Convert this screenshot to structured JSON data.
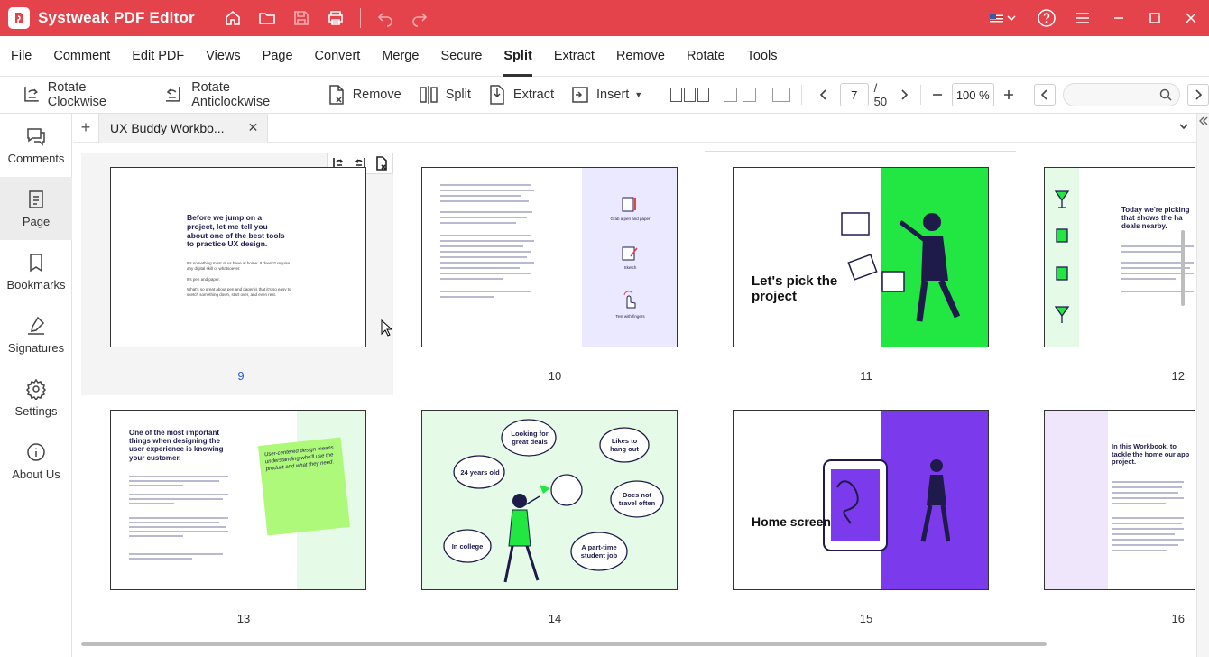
{
  "app": {
    "title": "Systweak PDF Editor"
  },
  "menu": {
    "items": [
      "File",
      "Comment",
      "Edit PDF",
      "Views",
      "Page",
      "Convert",
      "Merge",
      "Secure",
      "Split",
      "Extract",
      "Remove",
      "Rotate",
      "Tools"
    ],
    "active": "Split"
  },
  "toolbar": {
    "rotate_cw": "Rotate Clockwise",
    "rotate_acw": "Rotate Anticlockwise",
    "remove": "Remove",
    "split": "Split",
    "extract": "Extract",
    "insert": "Insert",
    "current_page": "7",
    "total_pages": "/ 50",
    "zoom": "100 %"
  },
  "sidebar": {
    "items": [
      {
        "label": "Comments",
        "icon": "comments-icon"
      },
      {
        "label": "Page",
        "icon": "page-icon"
      },
      {
        "label": "Bookmarks",
        "icon": "bookmark-icon"
      },
      {
        "label": "Signatures",
        "icon": "signature-icon"
      },
      {
        "label": "Settings",
        "icon": "gear-icon"
      },
      {
        "label": "About Us",
        "icon": "info-icon"
      }
    ],
    "active": "Page"
  },
  "tabs": [
    {
      "label": "UX Buddy Workbo..."
    }
  ],
  "pages": [
    {
      "number": "9",
      "selected": true,
      "heading": "Before we jump on a project, let me tell you about one of the best tools to practice UX design.",
      "body": [
        "It's something most of us have at home. It doesn't require any digital skill or whatsoever.",
        "It's pen and paper.",
        "What's so great about pen and paper is that it's so easy to sketch something down, start over, and even rest."
      ]
    },
    {
      "number": "10",
      "labels": [
        "Grab a pen and paper",
        "Sketch",
        "Test with fingers"
      ]
    },
    {
      "number": "11",
      "heading": "Let's pick the project"
    },
    {
      "number": "12",
      "heading": "Today we're picking that shows the ha deals nearby."
    },
    {
      "number": "13",
      "heading": "One of the most important things when designing the user experience is knowing your customer.",
      "note": "User-centered design means understanding who'll use the product and what they need."
    },
    {
      "number": "14",
      "bubbles": [
        "Looking for great deals",
        "Likes to hang out",
        "24 years old",
        "Does not travel often",
        "In college",
        "A part-time student job"
      ]
    },
    {
      "number": "15",
      "heading": "Home screen"
    },
    {
      "number": "16",
      "heading": "In this Workbook, to tackle the home our app project."
    }
  ],
  "colors": {
    "accent": "#e4434b",
    "green": "#22e642",
    "purple": "#7c3aed",
    "lavender": "#ebe9ff",
    "mint": "#e5fbe8"
  }
}
